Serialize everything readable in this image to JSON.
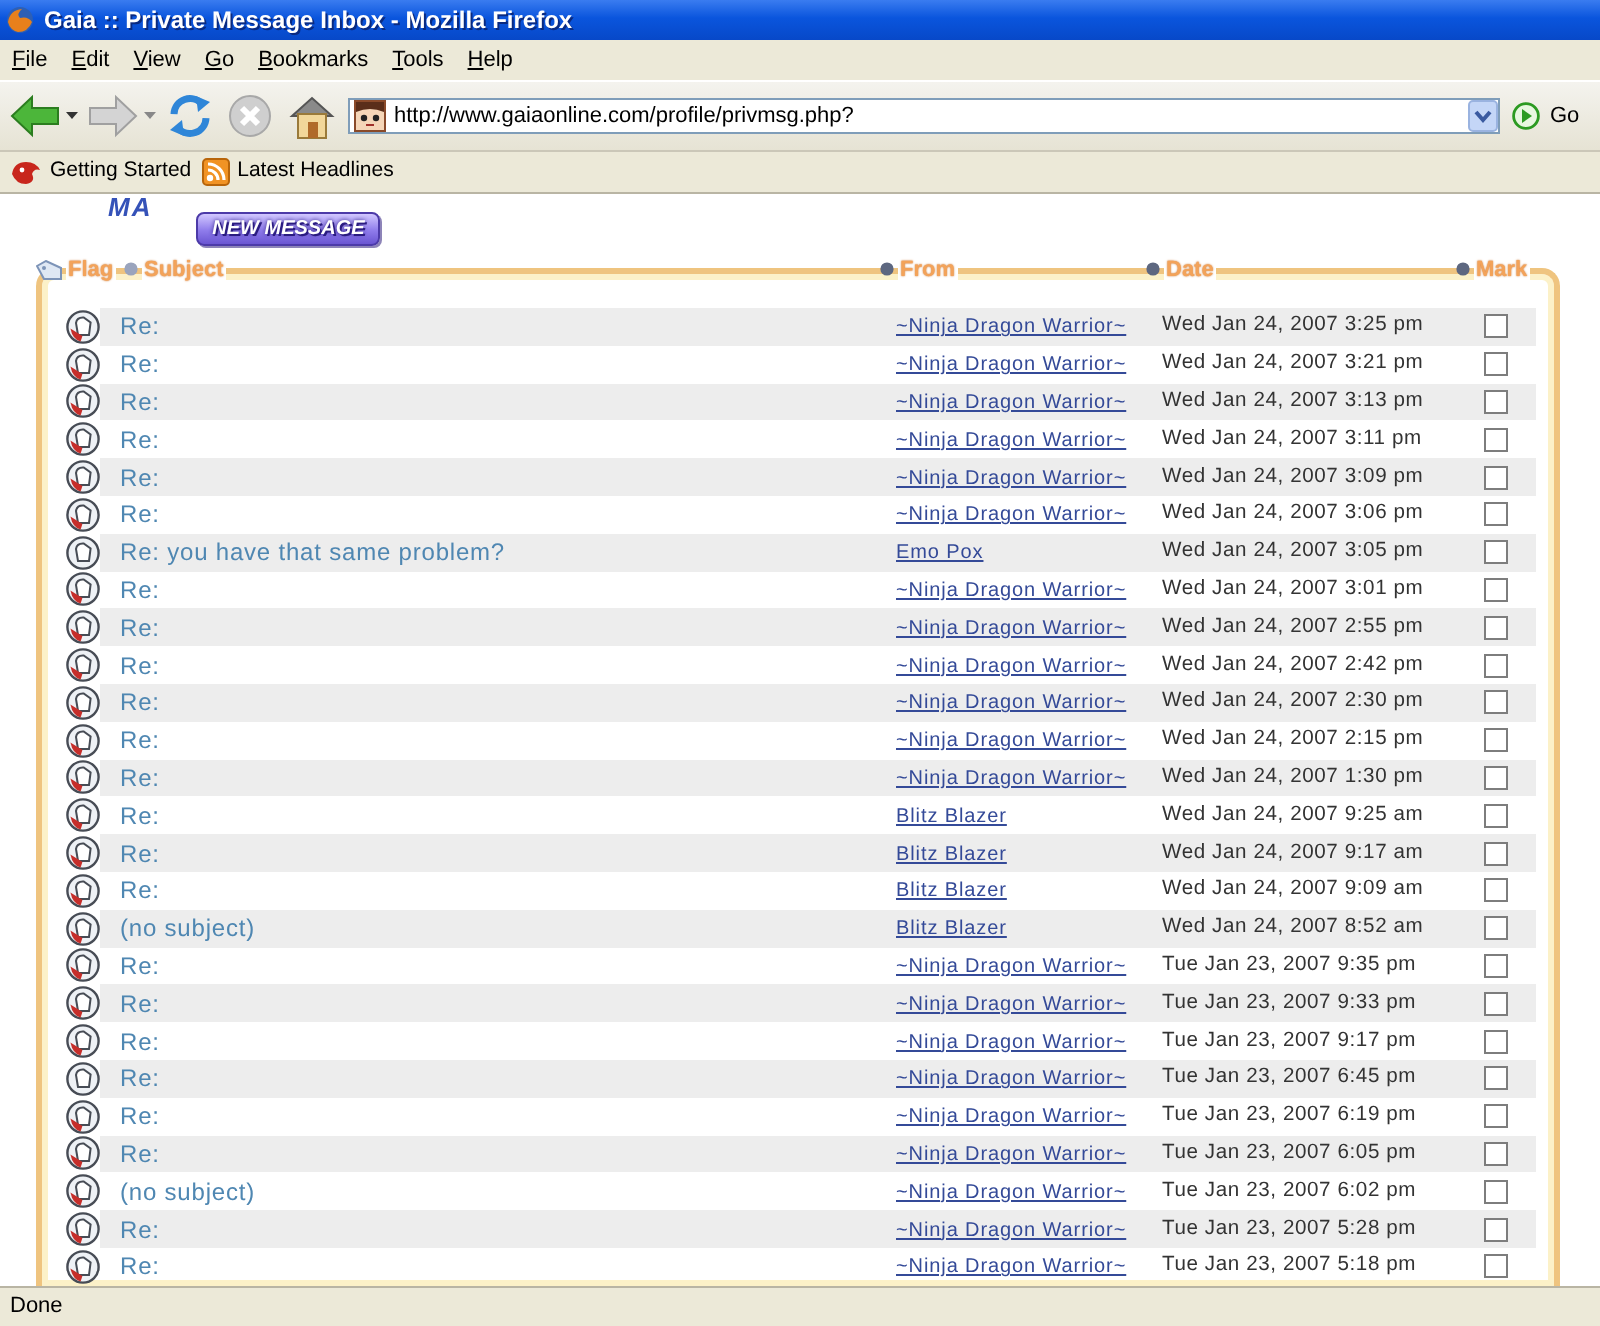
{
  "window": {
    "title": "Gaia :: Private Message Inbox - Mozilla Firefox"
  },
  "menu": [
    "File",
    "Edit",
    "View",
    "Go",
    "Bookmarks",
    "Tools",
    "Help"
  ],
  "toolbar": {
    "address": "http://www.gaiaonline.com/profile/privmsg.php?",
    "go_label": "Go"
  },
  "bookmarks": [
    {
      "label": "Getting Started",
      "kind": "page"
    },
    {
      "label": "Latest Headlines",
      "kind": "feed"
    }
  ],
  "page": {
    "heading": "MA",
    "new_message_button": "NEW MESSAGE"
  },
  "inbox": {
    "columns": [
      "Flag",
      "Subject",
      "From",
      "Date",
      "Mark"
    ],
    "rows": [
      {
        "subject": "Re:",
        "from": "~Ninja Dragon Warrior~",
        "date": "Wed Jan 24, 2007 3:25 pm",
        "replied": true,
        "checked": false
      },
      {
        "subject": "Re:",
        "from": "~Ninja Dragon Warrior~",
        "date": "Wed Jan 24, 2007 3:21 pm",
        "replied": true,
        "checked": false
      },
      {
        "subject": "Re:",
        "from": "~Ninja Dragon Warrior~",
        "date": "Wed Jan 24, 2007 3:13 pm",
        "replied": true,
        "checked": false
      },
      {
        "subject": "Re:",
        "from": "~Ninja Dragon Warrior~",
        "date": "Wed Jan 24, 2007 3:11 pm",
        "replied": true,
        "checked": false
      },
      {
        "subject": "Re:",
        "from": "~Ninja Dragon Warrior~",
        "date": "Wed Jan 24, 2007 3:09 pm",
        "replied": true,
        "checked": false
      },
      {
        "subject": "Re:",
        "from": "~Ninja Dragon Warrior~",
        "date": "Wed Jan 24, 2007 3:06 pm",
        "replied": true,
        "checked": false
      },
      {
        "subject": "Re: you have that same problem?",
        "from": "Emo Pox",
        "date": "Wed Jan 24, 2007 3:05 pm",
        "replied": false,
        "checked": false
      },
      {
        "subject": "Re:",
        "from": "~Ninja Dragon Warrior~",
        "date": "Wed Jan 24, 2007 3:01 pm",
        "replied": true,
        "checked": false
      },
      {
        "subject": "Re:",
        "from": "~Ninja Dragon Warrior~",
        "date": "Wed Jan 24, 2007 2:55 pm",
        "replied": true,
        "checked": false
      },
      {
        "subject": "Re:",
        "from": "~Ninja Dragon Warrior~",
        "date": "Wed Jan 24, 2007 2:42 pm",
        "replied": true,
        "checked": false
      },
      {
        "subject": "Re:",
        "from": "~Ninja Dragon Warrior~",
        "date": "Wed Jan 24, 2007 2:30 pm",
        "replied": true,
        "checked": false
      },
      {
        "subject": "Re:",
        "from": "~Ninja Dragon Warrior~",
        "date": "Wed Jan 24, 2007 2:15 pm",
        "replied": true,
        "checked": false
      },
      {
        "subject": "Re:",
        "from": "~Ninja Dragon Warrior~",
        "date": "Wed Jan 24, 2007 1:30 pm",
        "replied": true,
        "checked": false
      },
      {
        "subject": "Re:",
        "from": "Blitz Blazer",
        "date": "Wed Jan 24, 2007 9:25 am",
        "replied": true,
        "checked": false
      },
      {
        "subject": "Re:",
        "from": "Blitz Blazer",
        "date": "Wed Jan 24, 2007 9:17 am",
        "replied": true,
        "checked": false
      },
      {
        "subject": "Re:",
        "from": "Blitz Blazer",
        "date": "Wed Jan 24, 2007 9:09 am",
        "replied": true,
        "checked": false
      },
      {
        "subject": "(no subject)",
        "from": "Blitz Blazer",
        "date": "Wed Jan 24, 2007 8:52 am",
        "replied": true,
        "checked": false
      },
      {
        "subject": "Re:",
        "from": "~Ninja Dragon Warrior~",
        "date": "Tue Jan 23, 2007 9:35 pm",
        "replied": true,
        "checked": false
      },
      {
        "subject": "Re:",
        "from": "~Ninja Dragon Warrior~",
        "date": "Tue Jan 23, 2007 9:33 pm",
        "replied": true,
        "checked": false
      },
      {
        "subject": "Re:",
        "from": "~Ninja Dragon Warrior~",
        "date": "Tue Jan 23, 2007 9:17 pm",
        "replied": true,
        "checked": false
      },
      {
        "subject": "Re:",
        "from": "~Ninja Dragon Warrior~",
        "date": "Tue Jan 23, 2007 6:45 pm",
        "replied": false,
        "checked": false
      },
      {
        "subject": "Re:",
        "from": "~Ninja Dragon Warrior~",
        "date": "Tue Jan 23, 2007 6:19 pm",
        "replied": true,
        "checked": false
      },
      {
        "subject": "Re:",
        "from": "~Ninja Dragon Warrior~",
        "date": "Tue Jan 23, 2007 6:05 pm",
        "replied": true,
        "checked": false
      },
      {
        "subject": "(no subject)",
        "from": "~Ninja Dragon Warrior~",
        "date": "Tue Jan 23, 2007 6:02 pm",
        "replied": true,
        "checked": false
      },
      {
        "subject": "Re:",
        "from": "~Ninja Dragon Warrior~",
        "date": "Tue Jan 23, 2007 5:28 pm",
        "replied": true,
        "checked": false
      },
      {
        "subject": "Re:",
        "from": "~Ninja Dragon Warrior~",
        "date": "Tue Jan 23, 2007 5:18 pm",
        "replied": true,
        "checked": false
      }
    ]
  },
  "status_bar": {
    "text": "Done"
  }
}
